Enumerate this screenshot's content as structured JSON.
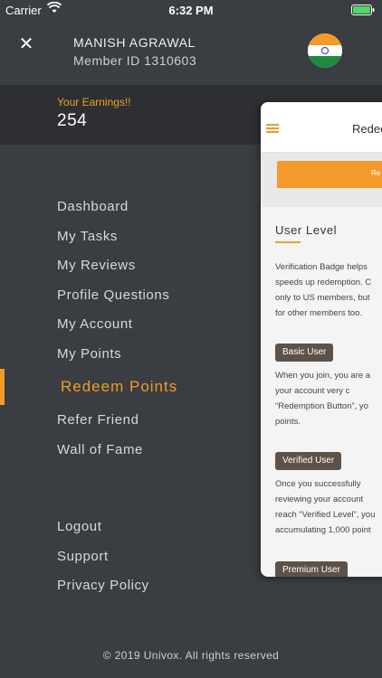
{
  "status_bar": {
    "carrier": "Carrier",
    "time": "6:32 PM"
  },
  "profile": {
    "name": "MANISH AGRAWAL",
    "member_id": "Member ID 1310603"
  },
  "earnings": {
    "label": "Your Earnings!!",
    "value": "254"
  },
  "menu": {
    "items": [
      "Dashboard",
      "My Tasks",
      "My Reviews",
      "Profile Questions",
      "My Account",
      "My Points"
    ],
    "active": "Redeem Points",
    "items2": [
      "Refer Friend",
      "Wall of Fame"
    ],
    "secondary": [
      "Logout",
      "Support",
      "Privacy Policy"
    ]
  },
  "footer": "© 2019 Univox. All rights reserved",
  "preview": {
    "title": "Redee",
    "button": "Re",
    "section_title": "User Level",
    "intro": [
      "Verification Badge helps",
      "speeds up redemption. C",
      "only to US members, but",
      "for other members too."
    ],
    "basic_badge": "Basic User",
    "basic_text": [
      "When you join, you are a",
      "your account very c",
      "“Redemption Button”, yo",
      "points."
    ],
    "verified_badge": "Verified User",
    "verified_text": [
      "Once you successfully",
      "reviewing your account",
      "reach “Verified Level”, you",
      "accumulating 1,000 point"
    ],
    "premium_badge": "Premium User"
  },
  "colors": {
    "accent": "#f39a2a",
    "background": "#3a3d42",
    "band": "#2d2f33"
  }
}
